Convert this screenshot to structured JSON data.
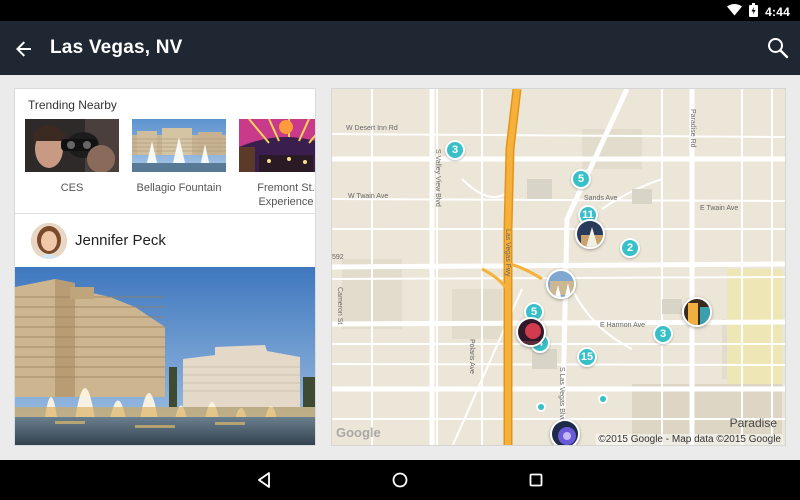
{
  "status_bar": {
    "time": "4:44",
    "icons": [
      "wifi-icon",
      "battery-icon"
    ]
  },
  "app_bar": {
    "title": "Las Vegas, NV",
    "back_icon": "arrow-back-icon",
    "search_icon": "search-icon"
  },
  "trending": {
    "title": "Trending Nearby",
    "items": [
      {
        "label": "CES"
      },
      {
        "label": "Bellagio Fountain"
      },
      {
        "label": "Fremont St. Experience"
      }
    ]
  },
  "post": {
    "author": "Jennifer Peck"
  },
  "map": {
    "streets": {
      "desert_inn": "W Desert Inn Rd",
      "twain": "W Twain Ave",
      "sands": "Sands Ave",
      "e_twain": "E Twain Ave",
      "harmon": "E Harmon Ave",
      "valley_view": "S Valley View Blvd",
      "cameron": "Cameron St",
      "polaris": "Polaris Ave",
      "las_vegas_fwy": "Las Vegas Fwy",
      "las_vegas_blvd": "S Las Vegas Blvd",
      "paradise_rd": "Paradise Rd",
      "route": "592"
    },
    "clusters": [
      "3",
      "5",
      "11",
      "2",
      "5",
      "4",
      "3",
      "15"
    ],
    "place_label": "Paradise",
    "logo": "Google",
    "attribution": "©2015 Google - Map data ©2015 Google"
  },
  "nav": {
    "back": "nav-back-icon",
    "home": "nav-home-icon",
    "recents": "nav-recents-icon"
  },
  "colors": {
    "app_bar": "#1f2733",
    "cluster": "#38c0c8",
    "freeway": "#f0a31e"
  }
}
